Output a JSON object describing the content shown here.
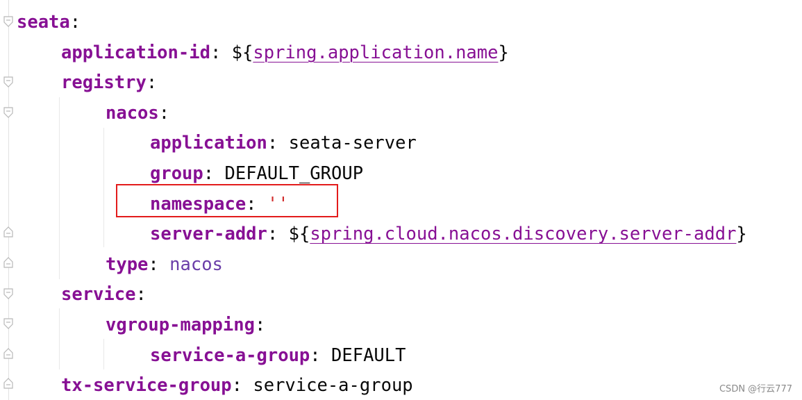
{
  "editor": {
    "lines": [
      {
        "id": "seata",
        "indent": 0,
        "key": "seata",
        "sep": ":",
        "value_type": "none"
      },
      {
        "id": "application-id",
        "indent": 1,
        "key": "application-id",
        "sep": ": ",
        "pre": "${",
        "ref": "spring.application.name",
        "post": "}",
        "value_type": "ref"
      },
      {
        "id": "registry",
        "indent": 1,
        "key": "registry",
        "sep": ":",
        "value_type": "none"
      },
      {
        "id": "nacos",
        "indent": 2,
        "key": "nacos",
        "sep": ":",
        "value_type": "none"
      },
      {
        "id": "application",
        "indent": 3,
        "key": "application",
        "sep": ": ",
        "value": "seata-server",
        "value_type": "plain"
      },
      {
        "id": "group",
        "indent": 3,
        "key": "group",
        "sep": ": ",
        "value": "DEFAULT_GROUP",
        "value_type": "plain"
      },
      {
        "id": "namespace",
        "indent": 3,
        "key": "namespace",
        "sep": ": ",
        "value": "''",
        "value_type": "string"
      },
      {
        "id": "server-addr",
        "indent": 3,
        "key": "server-addr",
        "sep": ": ",
        "pre": "${",
        "ref": "spring.cloud.nacos.discovery.server-addr",
        "post": "}",
        "value_type": "ref"
      },
      {
        "id": "type",
        "indent": 2,
        "key": "type",
        "sep": ": ",
        "value": "nacos",
        "value_type": "ident"
      },
      {
        "id": "service",
        "indent": 1,
        "key": "service",
        "sep": ":",
        "value_type": "none"
      },
      {
        "id": "vgroup-mapping",
        "indent": 2,
        "key": "vgroup-mapping",
        "sep": ":",
        "value_type": "none"
      },
      {
        "id": "service-a-group",
        "indent": 3,
        "key": "service-a-group",
        "sep": ": ",
        "value": "DEFAULT",
        "value_type": "plain"
      },
      {
        "id": "tx-service-group",
        "indent": 1,
        "key": "tx-service-group",
        "sep": ": ",
        "value": "service-a-group",
        "value_type": "plain"
      }
    ]
  },
  "colors": {
    "key": "#871094",
    "string": "#d22d2d",
    "highlight_box": "#e31b1b"
  },
  "highlighted_line": "namespace",
  "watermark": "CSDN @行云777"
}
